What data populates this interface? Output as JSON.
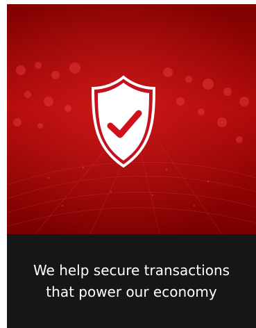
{
  "hero": {
    "icon": "shield-check-icon",
    "colors": {
      "background": "#8c0000",
      "shield": "#ffffff",
      "check": "#d0101b"
    }
  },
  "caption": {
    "text": "We help secure transactions that power our economy",
    "color": "#ffffff",
    "background": "#161616"
  }
}
